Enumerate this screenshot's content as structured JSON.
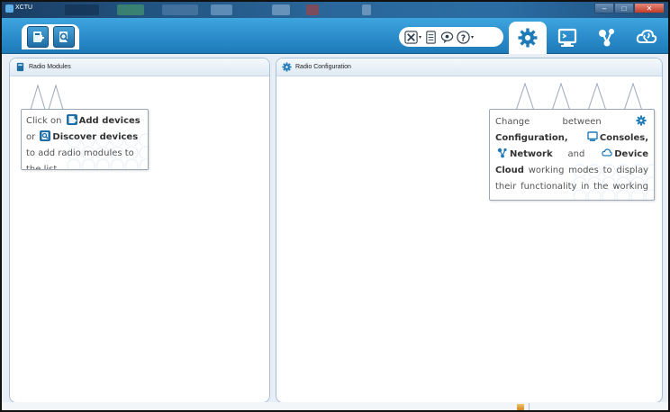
{
  "window": {
    "title": "XCTU",
    "controls": {
      "minimize": "–",
      "maximize": "□",
      "close": "✕"
    }
  },
  "toolbar": {
    "left_buttons": [
      {
        "name": "add-devices",
        "icon": "add-device-icon"
      },
      {
        "name": "discover-devices",
        "icon": "discover-devices-icon"
      }
    ],
    "tools": [
      {
        "name": "tools",
        "icon": "tools-icon",
        "caret": "▾"
      },
      {
        "name": "configuration-profile",
        "icon": "profile-icon"
      },
      {
        "name": "feedback",
        "icon": "feedback-icon"
      },
      {
        "name": "help",
        "icon": "help-icon",
        "caret": "▾"
      }
    ],
    "modes": [
      {
        "name": "configuration",
        "icon": "gear-icon",
        "active": true
      },
      {
        "name": "consoles",
        "icon": "console-icon",
        "active": false
      },
      {
        "name": "network",
        "icon": "network-icon",
        "active": false
      },
      {
        "name": "device-cloud",
        "icon": "cloud-icon",
        "active": false
      }
    ]
  },
  "left_panel": {
    "title": "Radio Modules",
    "callout": {
      "t1": "Click on",
      "add_devices": "Add devices",
      "t2": "or",
      "discover_devices": "Discover devices",
      "t3": "to add",
      "t4": "radio modules to the list."
    }
  },
  "right_panel": {
    "title": "Radio Configuration",
    "callout": {
      "t1": "Change between",
      "configuration": "Configuration,",
      "consoles": "Consoles,",
      "network": "Network",
      "t2": "and",
      "device_cloud": "Device Cloud",
      "t3": "working modes",
      "t4": "to display their functionality in",
      "t5": "the working area."
    }
  },
  "colors": {
    "toolbar": "#2a8ccb",
    "accent": "#1e6da5",
    "panel_border": "#a9c1d8"
  }
}
